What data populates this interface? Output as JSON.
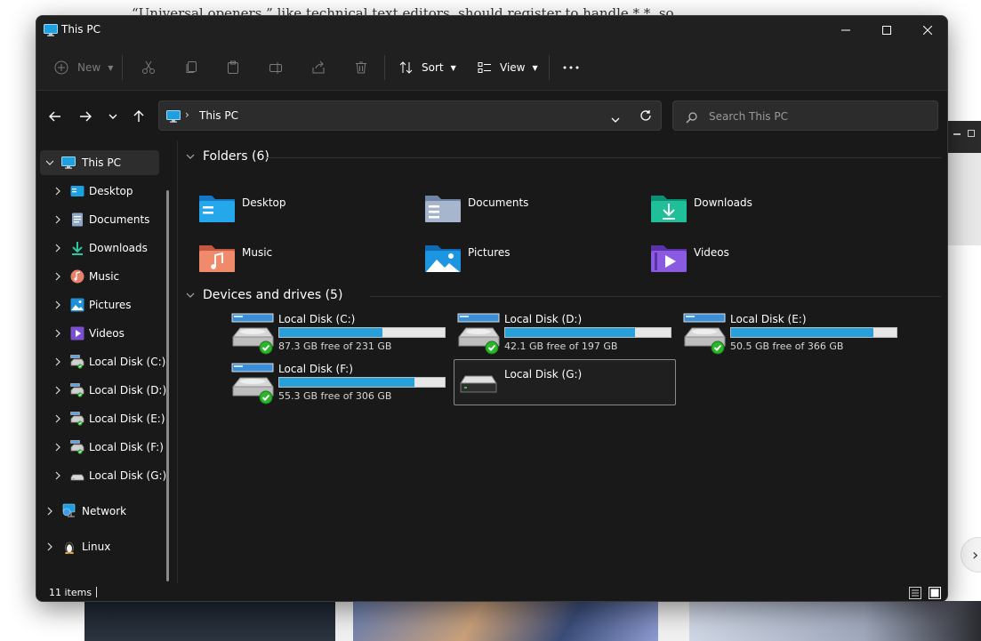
{
  "background": {
    "doc_text": "“Universal openers,” like technical text editors, should register to handle *.*, so",
    "next_arrow": "›"
  },
  "window": {
    "title": "This PC",
    "accent_color": "#26a0da"
  },
  "commandbar": {
    "new_label": "New",
    "sort_label": "Sort",
    "view_label": "View"
  },
  "address": {
    "separator": "›",
    "crumb": "This PC"
  },
  "search": {
    "placeholder": "Search This PC"
  },
  "sidebar": {
    "items": [
      {
        "label": "This PC",
        "icon": "monitor-icon"
      },
      {
        "label": "Desktop",
        "icon": "desktop-folder-icon"
      },
      {
        "label": "Documents",
        "icon": "documents-folder-icon"
      },
      {
        "label": "Downloads",
        "icon": "downloads-folder-icon"
      },
      {
        "label": "Music",
        "icon": "music-folder-icon"
      },
      {
        "label": "Pictures",
        "icon": "pictures-folder-icon"
      },
      {
        "label": "Videos",
        "icon": "videos-folder-icon"
      },
      {
        "label": "Local Disk (C:)",
        "icon": "drive-icon"
      },
      {
        "label": "Local Disk (D:)",
        "icon": "drive-icon"
      },
      {
        "label": "Local Disk (E:)",
        "icon": "drive-icon"
      },
      {
        "label": "Local Disk (F:)",
        "icon": "drive-icon"
      },
      {
        "label": "Local Disk (G:)",
        "icon": "removable-drive-icon"
      },
      {
        "label": "Network",
        "icon": "network-icon"
      },
      {
        "label": "Linux",
        "icon": "linux-penguin-icon"
      }
    ]
  },
  "folders_group": {
    "title": "Folders (6)",
    "items": [
      {
        "name": "Desktop",
        "icon": "desktop-folder-icon"
      },
      {
        "name": "Documents",
        "icon": "documents-folder-icon"
      },
      {
        "name": "Downloads",
        "icon": "downloads-folder-icon"
      },
      {
        "name": "Music",
        "icon": "music-folder-icon"
      },
      {
        "name": "Pictures",
        "icon": "pictures-folder-icon"
      },
      {
        "name": "Videos",
        "icon": "videos-folder-icon"
      }
    ]
  },
  "drives_group": {
    "title": "Devices and drives (5)",
    "items": [
      {
        "name": "Local Disk (C:)",
        "free": "87.3 GB free of 231 GB",
        "used_fraction": 0.622
      },
      {
        "name": "Local Disk (D:)",
        "free": "42.1 GB free of 197 GB",
        "used_fraction": 0.786
      },
      {
        "name": "Local Disk (E:)",
        "free": "50.5 GB free of 366 GB",
        "used_fraction": 0.862
      },
      {
        "name": "Local Disk (F:)",
        "free": "55.3 GB free of 306 GB",
        "used_fraction": 0.819
      },
      {
        "name": "Local Disk (G:)",
        "free": "",
        "used_fraction": null
      }
    ]
  },
  "status": {
    "items_count": "11 items"
  }
}
